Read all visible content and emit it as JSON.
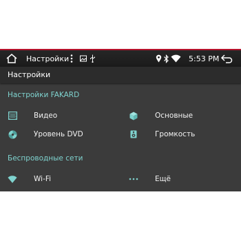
{
  "status_bar": {
    "app_title": "Настройки",
    "time": "5:53 PM",
    "icons": [
      "home-icon",
      "overflow-menu-icon",
      "gallery-icon",
      "usb-icon",
      "location-icon",
      "bluetooth-icon",
      "wifi-signal-icon",
      "back-icon"
    ]
  },
  "title_bar": {
    "title": "Настройки"
  },
  "sections": {
    "fakard": {
      "header": "Настройки FAKARD",
      "items": [
        {
          "label": "Видео",
          "icon": "video-film-icon"
        },
        {
          "label": "Основные",
          "icon": "cube-icon"
        },
        {
          "label": "Уровень DVD",
          "icon": "disc-icon"
        },
        {
          "label": "Громкость",
          "icon": "speaker-icon"
        }
      ]
    },
    "wireless": {
      "header": "Беспроводные сети",
      "items": [
        {
          "label": "Wi-Fi",
          "icon": "wifi-icon"
        },
        {
          "label": "Ещё",
          "icon": "more-dots-icon"
        }
      ]
    }
  },
  "colors": {
    "accent": "#7fd3cf",
    "status_bar_red_line": "#b5122b",
    "background": "#3b3b3b",
    "title_bar": "#2c2c2c"
  }
}
